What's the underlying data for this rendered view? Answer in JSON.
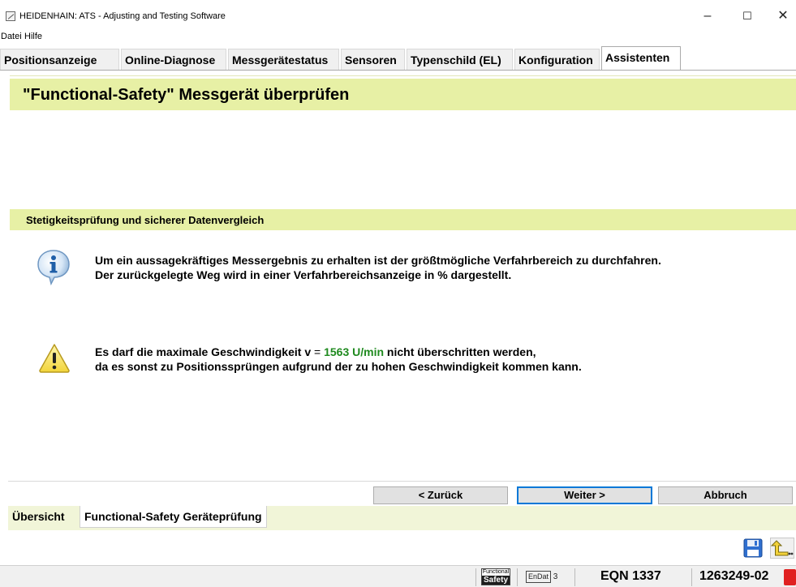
{
  "window": {
    "title": "HEIDENHAIN: ATS - Adjusting and Testing Software",
    "controls": {
      "minimize": "–",
      "maximize": "☐",
      "close": "✕"
    }
  },
  "menu": {
    "file": "Datei",
    "help": "Hilfe"
  },
  "tabs": [
    {
      "label": "Positionsanzeige",
      "active": false
    },
    {
      "label": "Online-Diagnose",
      "active": false
    },
    {
      "label": "Messgerätestatus",
      "active": false
    },
    {
      "label": "Sensoren",
      "active": false
    },
    {
      "label": "Typenschild (EL)",
      "active": false
    },
    {
      "label": "Konfiguration",
      "active": false
    },
    {
      "label": "Assistenten",
      "active": true
    }
  ],
  "page": {
    "title": "\"Functional-Safety\" Messgerät überprüfen",
    "section_title": "Stetigkeitsprüfung und sicherer Datenvergleich",
    "info": {
      "icon": "info-icon",
      "line1": "Um ein aussagekräftiges Messergebnis zu erhalten ist der größtmögliche Verfahrbereich zu durchfahren.",
      "line2": "Der zurückgelegte Weg wird in einer Verfahrbereichsanzeige in % dargestellt."
    },
    "warning": {
      "icon": "warning-icon",
      "line1_prefix": "Es darf die maximale Geschwindigkeit ",
      "speed_var": "v",
      "equals": " = ",
      "speed_value": "1563 U/min",
      "line1_suffix": " nicht überschritten werden,",
      "line2": "da es sonst zu Positionssprüngen aufgrund der zu hohen Geschwindigkeit kommen kann.",
      "speed_color": "#1f8a1f"
    }
  },
  "nav": {
    "back": "< Zurück",
    "next": "Weiter >",
    "cancel": "Abbruch"
  },
  "bottom_tabs": {
    "overview": "Übersicht",
    "functional": "Functional-Safety Geräteprüfung"
  },
  "toolbar": {
    "save_icon": "save-icon",
    "return_icon": "return-icon"
  },
  "status": {
    "fs_logo_top": "Functional",
    "fs_logo_bottom": "Safety",
    "endat": "EnDat",
    "endat_version": "3",
    "model": "EQN 1337",
    "serial": "1263249-02",
    "indicator_color": "#e02020"
  },
  "colors": {
    "band": "#e7f0a5",
    "bottom_tabs": "#f1f5d8",
    "focus": "#0078d7"
  }
}
